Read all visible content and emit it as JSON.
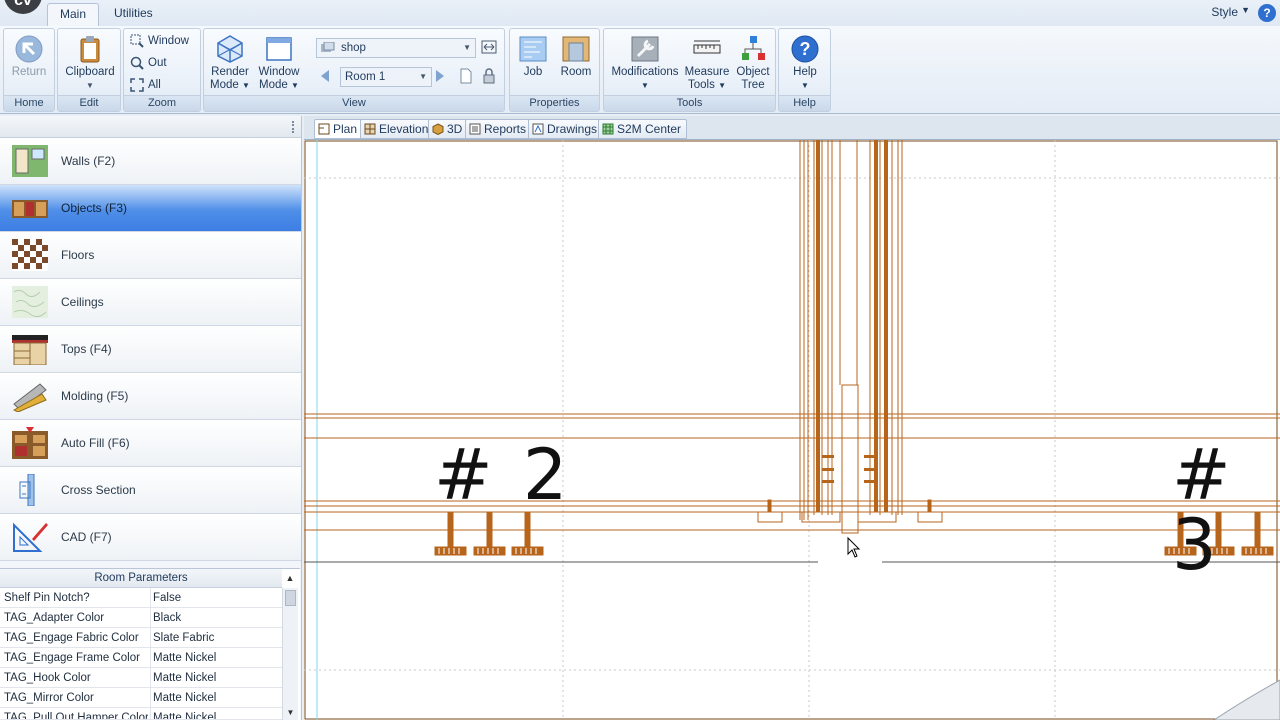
{
  "tabbar": {
    "logo": "cv",
    "tabs": [
      "Main",
      "Utilities"
    ],
    "style_label": "Style",
    "help_glyph": "?"
  },
  "ribbon": {
    "home": {
      "return_label": "Return",
      "group": "Home"
    },
    "edit": {
      "clipboard_label": "Clipboard",
      "group": "Edit"
    },
    "zoom": {
      "window": "Window",
      "out": "Out",
      "all": "All",
      "group": "Zoom"
    },
    "render": {
      "render_mode": "Render Mode",
      "window_mode": "Window Mode"
    },
    "view": {
      "scene_value": "shop",
      "room_value": "Room 1",
      "group": "View"
    },
    "properties": {
      "job": "Job",
      "room": "Room",
      "group": "Properties"
    },
    "tools": {
      "modifications": "Modifications",
      "measure_tools": "Measure Tools",
      "object_tree": "Object Tree",
      "group": "Tools"
    },
    "help": {
      "help": "Help",
      "group": "Help"
    }
  },
  "categories": [
    {
      "label": "Walls (F2)",
      "icon": "walls-icon"
    },
    {
      "label": "Objects (F3)",
      "icon": "objects-icon",
      "selected": true
    },
    {
      "label": "Floors",
      "icon": "floors-icon"
    },
    {
      "label": "Ceilings",
      "icon": "ceilings-icon"
    },
    {
      "label": "Tops (F4)",
      "icon": "tops-icon"
    },
    {
      "label": "Molding (F5)",
      "icon": "molding-icon"
    },
    {
      "label": "Auto Fill (F6)",
      "icon": "auto-fill-icon"
    },
    {
      "label": "Cross Section",
      "icon": "cross-section-icon"
    },
    {
      "label": "CAD (F7)",
      "icon": "cad-icon"
    }
  ],
  "room_params": {
    "title": "Room Parameters",
    "rows": [
      {
        "key": "Shelf Pin Notch?",
        "value": "False"
      },
      {
        "key": "TAG_Adapter Color",
        "value": "Black"
      },
      {
        "key": "TAG_Engage Fabric Color",
        "value": "Slate Fabric"
      },
      {
        "key": "TAG_Engage Frame Color",
        "value": "Matte Nickel"
      },
      {
        "key": "TAG_Hook Color",
        "value": "Matte Nickel"
      },
      {
        "key": "TAG_Mirror Color",
        "value": "Matte Nickel"
      },
      {
        "key": "TAG_Pull Out Hamper Color",
        "value": "Matte Nickel"
      }
    ]
  },
  "view_tabs": [
    "Plan",
    "Elevation",
    "3D",
    "Reports",
    "Drawings",
    "S2M Center"
  ],
  "canvas": {
    "labels": [
      "# 2",
      "# 3"
    ],
    "accent": "#b8651c"
  }
}
